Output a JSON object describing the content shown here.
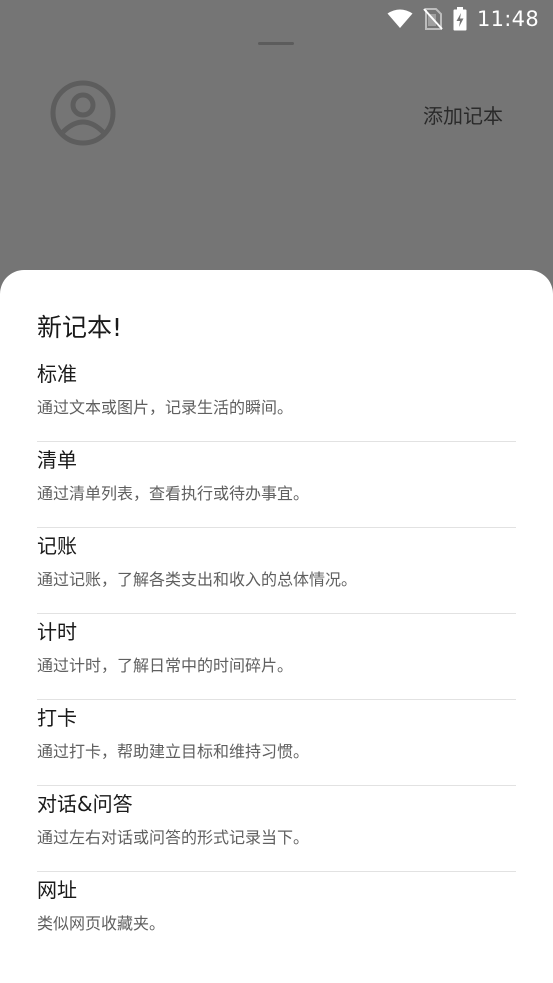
{
  "status_bar": {
    "time": "11:48",
    "icons": [
      "wifi-icon",
      "no-sim-icon",
      "battery-charging-icon"
    ]
  },
  "background": {
    "add_notebook_label": "添加记本",
    "avatar_icon": "user-avatar-icon"
  },
  "sheet": {
    "title": "新记本!",
    "options": [
      {
        "title": "标准",
        "description": "通过文本或图片，记录生活的瞬间。"
      },
      {
        "title": "清单",
        "description": "通过清单列表，查看执行或待办事宜。"
      },
      {
        "title": "记账",
        "description": "通过记账，了解各类支出和收入的总体情况。"
      },
      {
        "title": "计时",
        "description": "通过计时，了解日常中的时间碎片。"
      },
      {
        "title": "打卡",
        "description": "通过打卡，帮助建立目标和维持习惯。"
      },
      {
        "title": "对话&问答",
        "description": "通过左右对话或问答的形式记录当下。"
      },
      {
        "title": "网址",
        "description": "类似网页收藏夹。"
      }
    ]
  },
  "colors": {
    "scrim": "#757575",
    "sheet_bg": "#ffffff",
    "divider": "#e2e2e2",
    "primary_text": "#1a1a1a",
    "secondary_text": "#5f5f5f"
  }
}
